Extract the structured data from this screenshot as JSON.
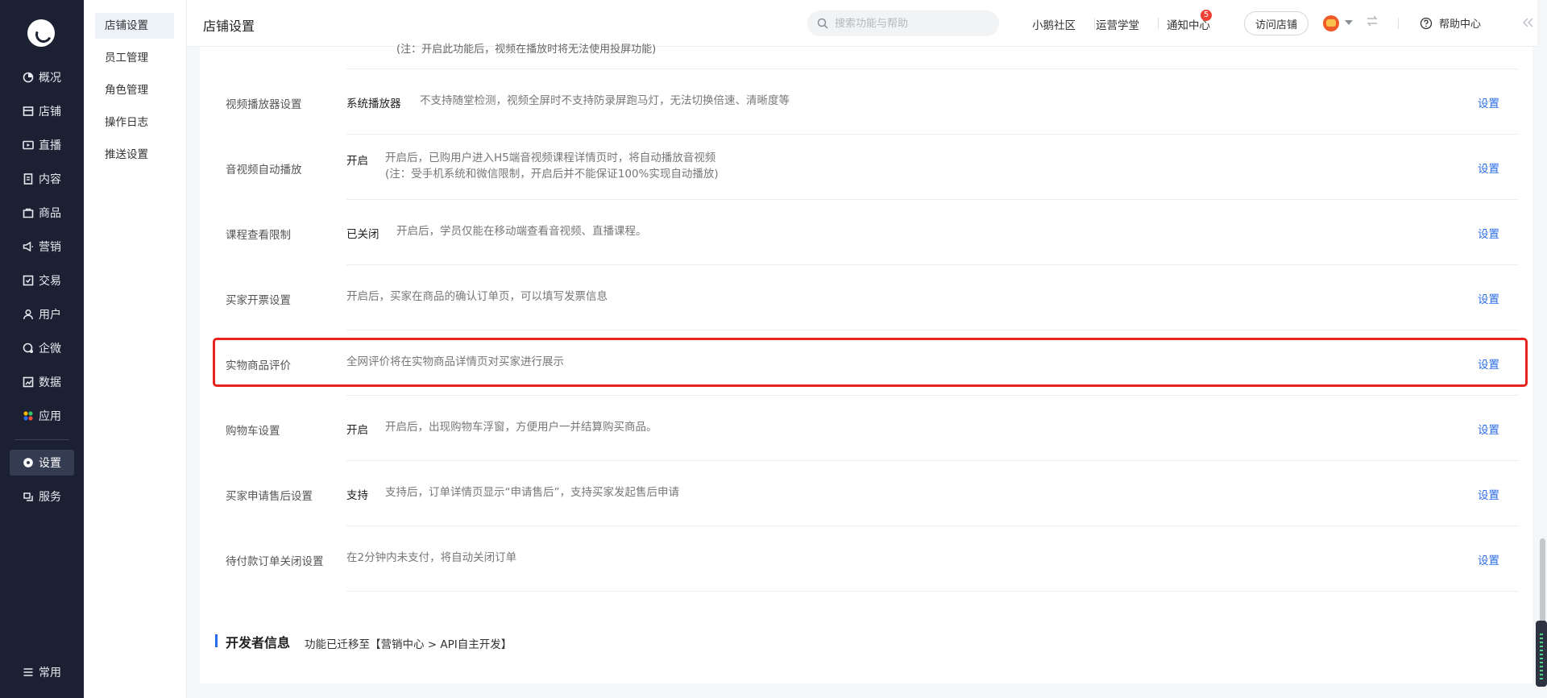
{
  "nav": {
    "items": [
      {
        "label": "概况",
        "icon": "overview-icon"
      },
      {
        "label": "店铺",
        "icon": "shop-icon"
      },
      {
        "label": "直播",
        "icon": "live-icon"
      },
      {
        "label": "内容",
        "icon": "content-icon"
      },
      {
        "label": "商品",
        "icon": "goods-icon"
      },
      {
        "label": "营销",
        "icon": "marketing-icon"
      },
      {
        "label": "交易",
        "icon": "trade-icon"
      },
      {
        "label": "用户",
        "icon": "user-icon"
      },
      {
        "label": "企微",
        "icon": "wecom-icon"
      },
      {
        "label": "数据",
        "icon": "data-icon"
      },
      {
        "label": "应用",
        "icon": "apps-icon"
      }
    ],
    "settings": {
      "label": "设置",
      "icon": "gear-icon"
    },
    "service": {
      "label": "服务",
      "icon": "service-icon"
    },
    "common": {
      "label": "常用",
      "icon": "list-icon"
    }
  },
  "submenu": {
    "items": [
      "店铺设置",
      "员工管理",
      "角色管理",
      "操作日志",
      "推送设置"
    ],
    "active_index": 0
  },
  "header": {
    "title": "店铺设置",
    "search_placeholder": "搜索功能与帮助",
    "links": [
      "小鹅社区",
      "运营学堂",
      "通知中心"
    ],
    "notification_count": "5",
    "visit_button": "访问店铺",
    "help": "帮助中心"
  },
  "content": {
    "cut_text": "(注：开启此功能后，视频在播放时将无法使用投屏功能)",
    "action_label": "设置",
    "rows": [
      {
        "label": "视频播放器设置",
        "status": "系统播放器",
        "desc": [
          "不支持随堂检测，视频全屏时不支持防录屏跑马灯，无法切换倍速、清晰度等"
        ]
      },
      {
        "label": "音视频自动播放",
        "status": "开启",
        "desc": [
          "开启后，已购用户进入H5端音视频课程详情页时，将自动播放音视频",
          "(注：受手机系统和微信限制，开启后并不能保证100%实现自动播放)"
        ]
      },
      {
        "label": "课程查看限制",
        "status": "已关闭",
        "desc": [
          "开启后，学员仅能在移动端查看音视频、直播课程。"
        ]
      },
      {
        "label": "买家开票设置",
        "status": "",
        "desc": [
          "开启后，买家在商品的确认订单页，可以填写发票信息"
        ]
      },
      {
        "label": "实物商品评价",
        "status": "",
        "desc": [
          "全网评价将在实物商品详情页对买家进行展示"
        ]
      },
      {
        "label": "购物车设置",
        "status": "开启",
        "desc": [
          "开启后，出现购物车浮窗，方便用户一并结算购买商品。"
        ]
      },
      {
        "label": "买家申请售后设置",
        "status": "支持",
        "desc": [
          "支持后，订单详情页显示“申请售后”，支持买家发起售后申请"
        ]
      },
      {
        "label": "待付款订单关闭设置",
        "status": "",
        "desc": [
          "在2分钟内未支付，将自动关闭订单"
        ]
      }
    ],
    "developer": {
      "title": "开发者信息",
      "desc": "功能已迁移至【营销中心 > API自主开发】"
    }
  },
  "colors": {
    "nav_bg": "#1b2133",
    "accent": "#2a6ce8",
    "highlight": "#e8231b"
  }
}
